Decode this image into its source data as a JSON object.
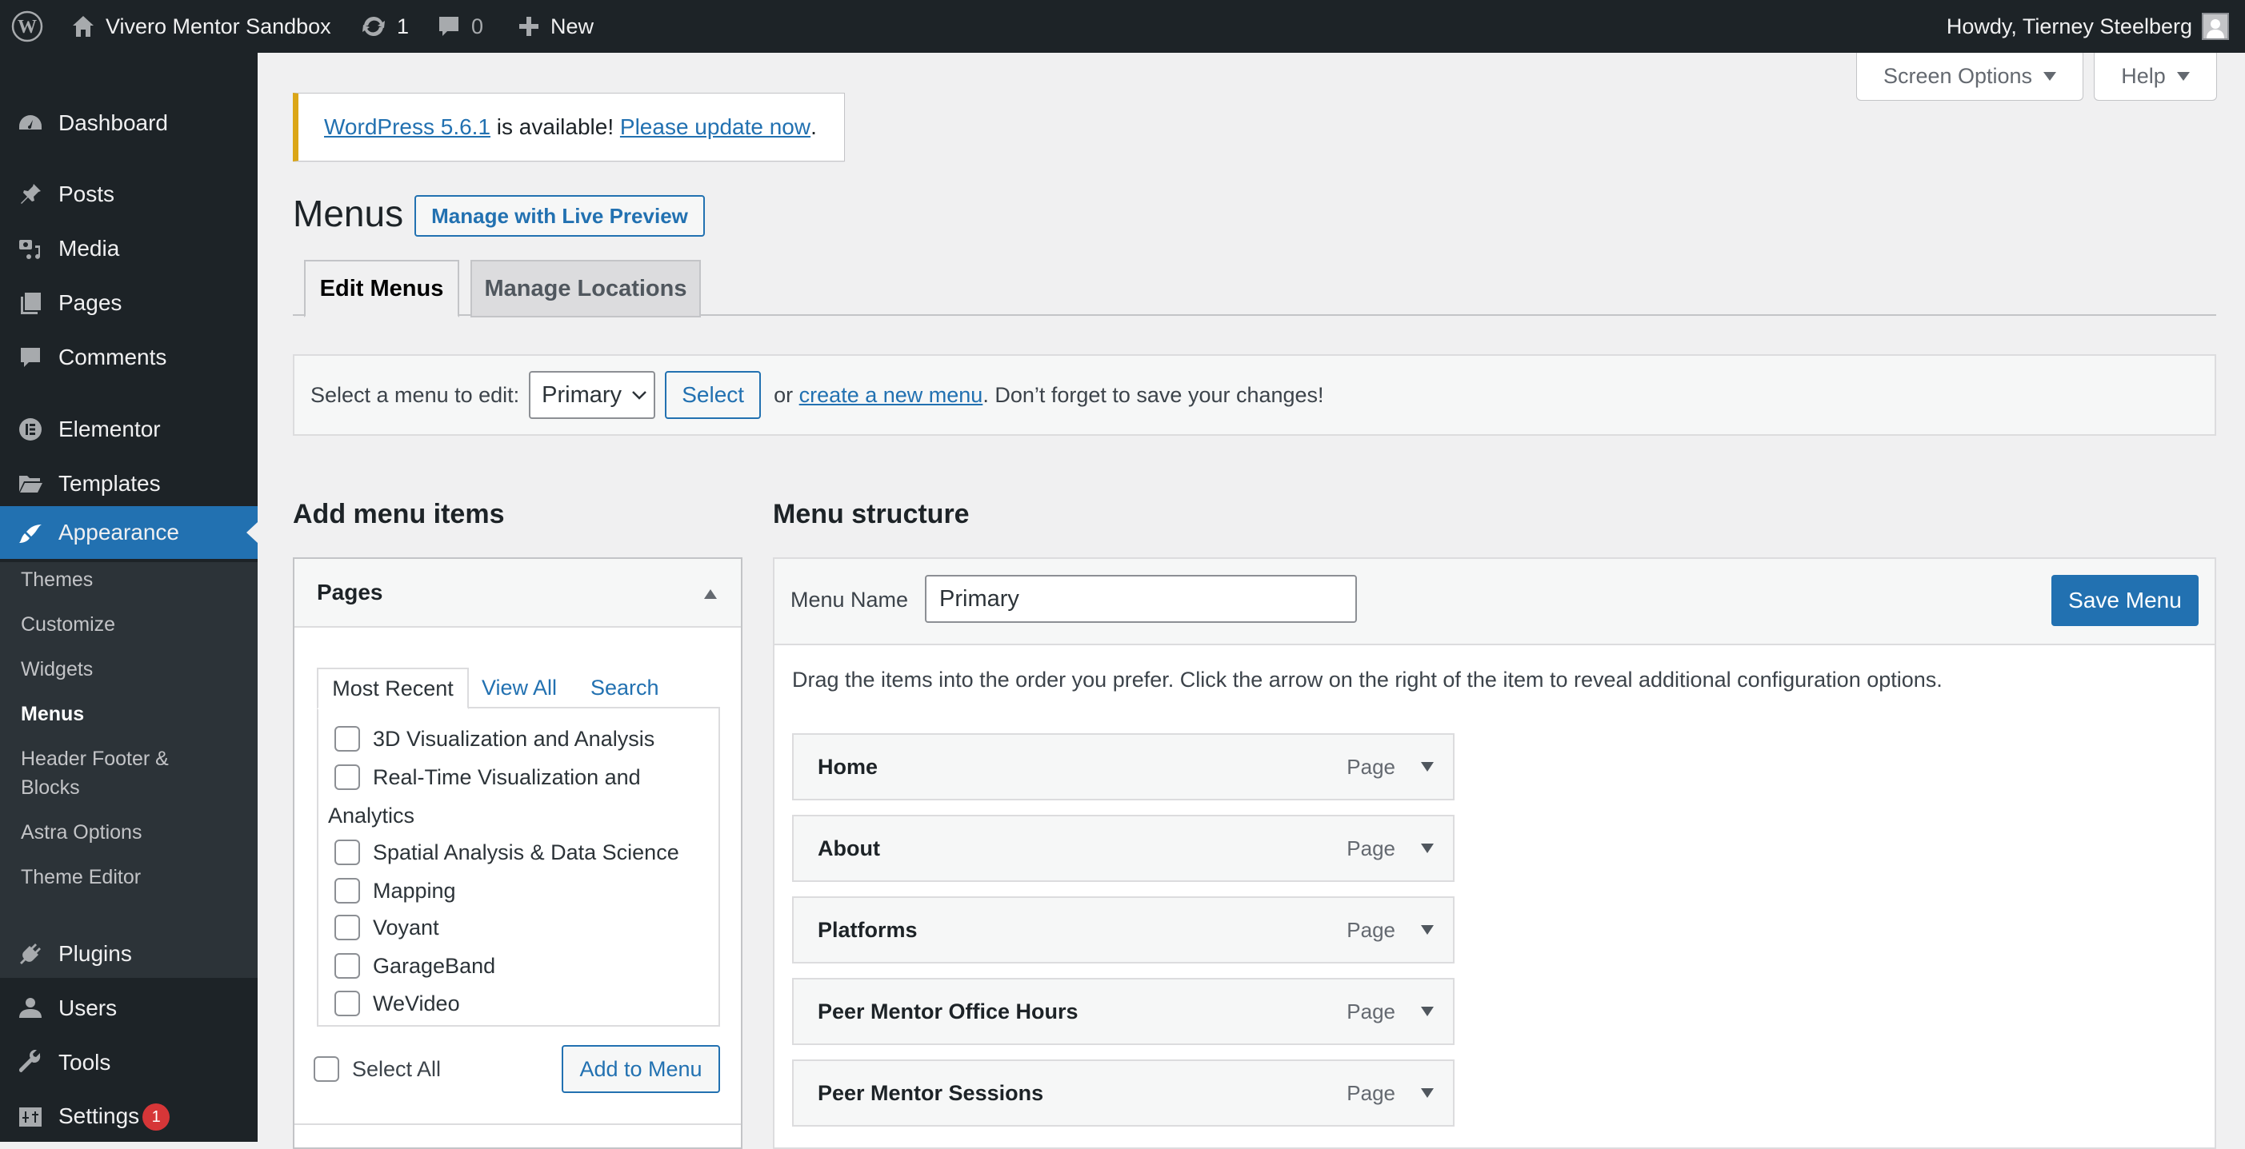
{
  "topbar": {
    "site_name": "Vivero Mentor Sandbox",
    "updates_count": "1",
    "comments_count": "0",
    "new_label": "New",
    "howdy": "Howdy, Tierney Steelberg"
  },
  "sidebar": {
    "items": [
      {
        "label": "Dashboard",
        "icon": "dashboard-icon"
      },
      {
        "label": "Posts",
        "icon": "pin-icon"
      },
      {
        "label": "Media",
        "icon": "media-icon"
      },
      {
        "label": "Pages",
        "icon": "pages-icon"
      },
      {
        "label": "Comments",
        "icon": "comment-icon"
      },
      {
        "label": "Elementor",
        "icon": "elementor-icon"
      },
      {
        "label": "Templates",
        "icon": "folder-icon"
      },
      {
        "label": "Appearance",
        "icon": "brush-icon"
      },
      {
        "label": "Plugins",
        "icon": "plug-icon"
      },
      {
        "label": "Users",
        "icon": "user-icon"
      },
      {
        "label": "Tools",
        "icon": "wrench-icon"
      },
      {
        "label": "Settings",
        "icon": "settings-icon",
        "badge": "1"
      }
    ],
    "submenu": [
      "Themes",
      "Customize",
      "Widgets",
      "Menus",
      "Header Footer &",
      "Blocks",
      "Astra Options",
      "Theme Editor"
    ],
    "current_submenu": "Menus"
  },
  "header_buttons": {
    "screen_options": "Screen Options",
    "help": "Help"
  },
  "notice": {
    "link1": "WordPress 5.6.1",
    "text": " is available! ",
    "link2": "Please update now",
    "end": "."
  },
  "page": {
    "title": "Menus",
    "live_preview": "Manage with Live Preview",
    "tabs": [
      "Edit Menus",
      "Manage Locations"
    ]
  },
  "select_bar": {
    "label": "Select a menu to edit:",
    "selected": "Primary",
    "select_button": "Select",
    "or": "or ",
    "create_link": "create a new menu",
    "tail": ". Don’t forget to save your changes!"
  },
  "add_items": {
    "heading": "Add menu items",
    "box_title": "Pages",
    "tabs": [
      "Most Recent",
      "View All",
      "Search"
    ],
    "pages": [
      "3D Visualization and Analysis",
      "Real-Time Visualization and",
      "Analytics",
      "Spatial Analysis & Data Science",
      "Mapping",
      "Voyant",
      "GarageBand",
      "WeVideo"
    ],
    "select_all": "Select All",
    "add_button": "Add to Menu"
  },
  "menu_structure": {
    "heading": "Menu structure",
    "name_label": "Menu Name",
    "name_value": "Primary",
    "save_button": "Save Menu",
    "instructions": "Drag the items into the order you prefer. Click the arrow on the right of the item to reveal additional configuration options.",
    "items": [
      {
        "title": "Home",
        "type": "Page"
      },
      {
        "title": "About",
        "type": "Page"
      },
      {
        "title": "Platforms",
        "type": "Page"
      },
      {
        "title": "Peer Mentor Office Hours",
        "type": "Page"
      },
      {
        "title": "Peer Mentor Sessions",
        "type": "Page"
      }
    ]
  },
  "colors": {
    "accent": "#2271b1",
    "adminbar": "#1d2327",
    "notice_warning": "#dba617",
    "badge": "#d63638"
  }
}
